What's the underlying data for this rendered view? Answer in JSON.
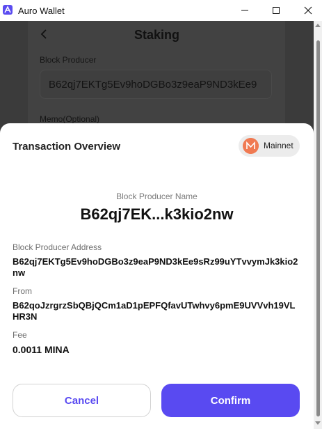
{
  "window": {
    "title": "Auro Wallet",
    "controls": {
      "minimize": "minimize-icon",
      "maximize": "maximize-icon",
      "close": "close-icon"
    }
  },
  "background_page": {
    "title": "Staking",
    "block_producer_label": "Block Producer",
    "block_producer_value": "B62qj7EKTg5Ev9hoDGBo3z9eaP9ND3kEe9",
    "memo_label": "Memo(Optional)"
  },
  "sheet": {
    "title": "Transaction Overview",
    "network": {
      "label": "Mainnet",
      "icon": "mina-logo-icon",
      "color": "#f07a52"
    },
    "block_producer_name_label": "Block Producer Name",
    "block_producer_name": "B62qj7EK...k3kio2nw",
    "fields": {
      "address_label": "Block Producer Address",
      "address_value": "B62qj7EKTg5Ev9hoDGBo3z9eaP9ND3kEe9sRz99uYTvvymJk3kio2nw",
      "from_label": "From",
      "from_value": "B62qoJzrgrzSbQBjQCm1aD1pEPFQfavUTwhvy6pmE9UVVvh19VLHR3N",
      "fee_label": "Fee",
      "fee_value": "0.0011 MINA"
    },
    "buttons": {
      "cancel": "Cancel",
      "confirm": "Confirm"
    }
  },
  "colors": {
    "accent": "#594af1",
    "overlay": "#3b3b3b"
  }
}
